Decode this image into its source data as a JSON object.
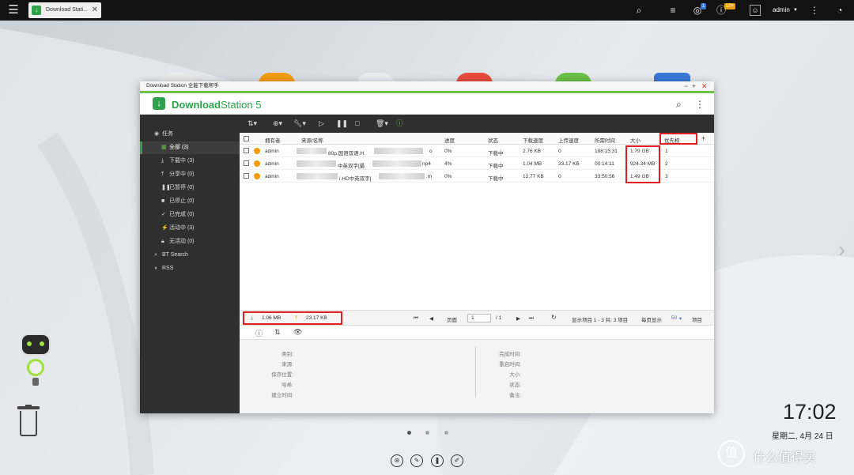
{
  "taskbar": {
    "tab_label": "Download Stati...",
    "user": "admin",
    "badge_1": "1",
    "badge_2": "10+"
  },
  "window": {
    "title": "Download Station 全能下载帮手",
    "app_name_a": "Download",
    "app_name_b": "Station 5"
  },
  "sidebar": {
    "items": [
      {
        "label": "任务",
        "icon": "task-icon"
      },
      {
        "label": "全部 (3)",
        "icon": "all-icon"
      },
      {
        "label": "下载中 (3)",
        "icon": "download-icon"
      },
      {
        "label": "分享中 (0)",
        "icon": "share-icon"
      },
      {
        "label": "已暂停 (0)",
        "icon": "pause-icon"
      },
      {
        "label": "已停止 (0)",
        "icon": "stop-icon"
      },
      {
        "label": "已完成 (0)",
        "icon": "check-icon"
      },
      {
        "label": "活动中 (3)",
        "icon": "active-icon"
      },
      {
        "label": "无活动 (0)",
        "icon": "lock-icon"
      },
      {
        "label": "BT Search",
        "icon": "search-icon"
      },
      {
        "label": "RSS",
        "icon": "rss-icon"
      }
    ]
  },
  "table": {
    "columns": [
      "拥有者",
      "来源/名称",
      "进度",
      "状态",
      "下载速度",
      "上传速度",
      "所需时间",
      "大小",
      "优先权"
    ],
    "rows": [
      {
        "owner": "admin",
        "name_a": "80p.国语双语.H",
        "name_b": "o",
        "progress": "0%",
        "status": "下载中",
        "down": "2.76 KB",
        "up": "0",
        "time": "188:15:31",
        "size": "1.79 GB",
        "priority": "1"
      },
      {
        "owner": "admin",
        "name_a": "中英双字[最",
        "name_b": "np4",
        "progress": "4%",
        "status": "下载中",
        "down": "1.04 MB",
        "up": "23.17 KB",
        "time": "00:14:11",
        "size": "924.34 MB",
        "priority": "2"
      },
      {
        "owner": "admin",
        "name_a": "i.HD中英双字[",
        "name_b": ".m",
        "progress": "0%",
        "status": "下载中",
        "down": "12.77 KB",
        "up": "0",
        "time": "33:50:56",
        "size": "1.49 GB",
        "priority": "3"
      }
    ]
  },
  "statusbar": {
    "down_total": "1.06 MB",
    "up_total": "23.17 KB",
    "page_label": "页面",
    "page_value": "1",
    "page_of": "/ 1",
    "display": "显示项目 1 - 3 共: 3 项目",
    "per_page_label": "每页显示",
    "per_page": "50",
    "items_label": "项目"
  },
  "details": {
    "left": [
      "类别:",
      "来源:",
      "保存位置:",
      "哈希:",
      "建立时间:"
    ],
    "right": [
      "完成时间:",
      "重启时间:",
      "大小:",
      "状态:",
      "备注:"
    ]
  },
  "desktop": {
    "time": "17:02",
    "date": "星期二, 4月 24 日",
    "watermark": "什么值得买",
    "watermark_logo": "值"
  }
}
